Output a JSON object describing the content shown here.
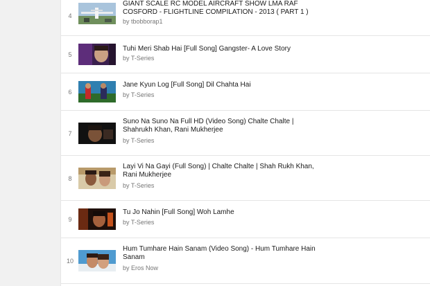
{
  "playlist": {
    "items": [
      {
        "index": "4",
        "title": "GIANT SCALE RC MODEL AIRCRAFT SHOW LMA RAF COSFORD - FLIGHTLINE COMPILATION - 2013 ( PART 1 )",
        "channel": "by tbobborap1",
        "thumbnail": "aircraft-show-thumbnail"
      },
      {
        "index": "5",
        "title": "Tuhi Meri Shab Hai [Full Song] Gangster- A Love Story",
        "channel": "by T-Series",
        "thumbnail": "song-video-thumbnail"
      },
      {
        "index": "6",
        "title": "Jane Kyun Log [Full Song] Dil Chahta Hai",
        "channel": "by T-Series",
        "thumbnail": "song-video-thumbnail"
      },
      {
        "index": "7",
        "title": "Suno Na Suno Na Full HD (Video Song) Chalte Chalte | Shahrukh Khan, Rani Mukherjee",
        "channel": "by T-Series",
        "thumbnail": "song-video-thumbnail"
      },
      {
        "index": "8",
        "title": "Layi Vi Na Gayi (Full Song) | Chalte Chalte | Shah Rukh Khan, Rani Mukherjee",
        "channel": "by T-Series",
        "thumbnail": "song-video-thumbnail"
      },
      {
        "index": "9",
        "title": "Tu Jo Nahin [Full Song] Woh Lamhe",
        "channel": "by T-Series",
        "thumbnail": "song-video-thumbnail"
      },
      {
        "index": "10",
        "title": "Hum Tumhare Hain Sanam (Video Song) - Hum Tumhare Hain Sanam",
        "channel": "by Eros Now",
        "thumbnail": "song-video-thumbnail"
      }
    ]
  },
  "colors": {
    "page_background": "#f1f1f1",
    "panel_background": "#ffffff",
    "divider": "#e5e5e5",
    "title_text": "#1a1a1a",
    "secondary_text": "#767676"
  }
}
